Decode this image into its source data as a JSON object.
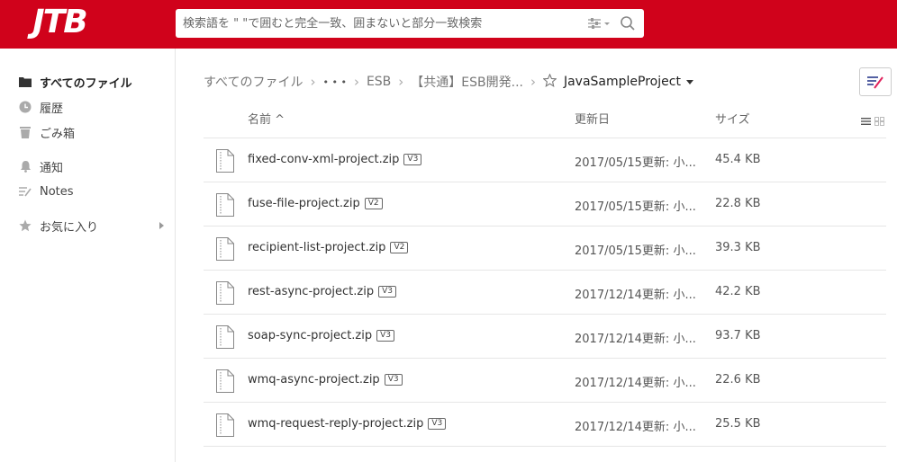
{
  "brand": {
    "logo_text": "JTB",
    "color": "#d0021b"
  },
  "search": {
    "placeholder": "検索語を \" \"で囲むと完全一致、囲まないと部分一致検索"
  },
  "sidebar": {
    "items": [
      {
        "label": "すべてのファイル",
        "icon": "folder-icon",
        "active": true
      },
      {
        "label": "履歴",
        "icon": "clock-icon"
      },
      {
        "label": "ごみ箱",
        "icon": "trash-icon"
      },
      {
        "label": "通知",
        "icon": "bell-icon"
      },
      {
        "label": "Notes",
        "icon": "notes-icon"
      },
      {
        "label": "お気に入り",
        "icon": "star-icon"
      }
    ]
  },
  "breadcrumb": {
    "root": "すべてのファイル",
    "ellipsis": "• • •",
    "level1": "ESB",
    "level2": "【共通】ESB開発...",
    "current": "JavaSampleProject"
  },
  "table": {
    "columns": {
      "name": "名前 ^",
      "updated": "更新日",
      "size": "サイズ"
    },
    "rows": [
      {
        "name": "fixed-conv-xml-project.zip",
        "version": "V3",
        "updated": "2017/05/15更新: 小...",
        "size": "45.4 KB"
      },
      {
        "name": "fuse-file-project.zip",
        "version": "V2",
        "updated": "2017/05/15更新: 小...",
        "size": "22.8 KB"
      },
      {
        "name": "recipient-list-project.zip",
        "version": "V2",
        "updated": "2017/05/15更新: 小...",
        "size": "39.3 KB"
      },
      {
        "name": "rest-async-project.zip",
        "version": "V3",
        "updated": "2017/12/14更新: 小...",
        "size": "42.2 KB"
      },
      {
        "name": "soap-sync-project.zip",
        "version": "V3",
        "updated": "2017/12/14更新: 小...",
        "size": "93.7 KB"
      },
      {
        "name": "wmq-async-project.zip",
        "version": "V3",
        "updated": "2017/12/14更新: 小...",
        "size": "22.6 KB"
      },
      {
        "name": "wmq-request-reply-project.zip",
        "version": "V3",
        "updated": "2017/12/14更新: 小...",
        "size": "25.5 KB"
      }
    ]
  }
}
